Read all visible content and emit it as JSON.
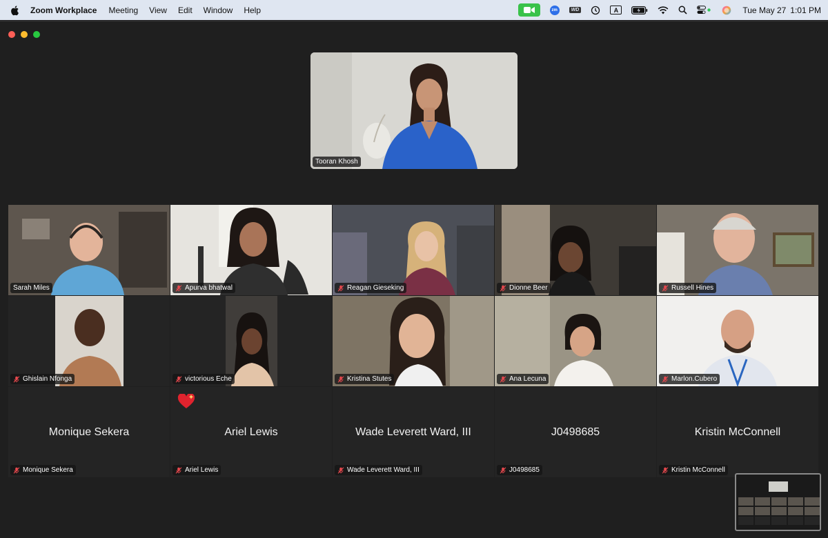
{
  "menubar": {
    "app_name": "Zoom Workplace",
    "menus": [
      "Meeting",
      "View",
      "Edit",
      "Window",
      "Help"
    ],
    "status_icons": [
      "video-camera-icon",
      "zoom-icon",
      "wd-drive-icon",
      "time-machine-icon",
      "input-source-icon",
      "battery-icon",
      "wifi-icon",
      "search-icon",
      "control-center-icon",
      "siri-icon"
    ],
    "zoom_badge": "zm",
    "wd_badge": "WD",
    "input_source": "A",
    "date": "Tue May 27",
    "time": "1:01 PM"
  },
  "window": {
    "traffic_lights": [
      "close",
      "minimize",
      "maximize"
    ]
  },
  "active_speaker": {
    "name": "Tooran Khosh"
  },
  "participants": [
    {
      "name": "Sarah Miles",
      "muted": false,
      "video": true
    },
    {
      "name": "Apurva bhatwal",
      "muted": true,
      "video": true
    },
    {
      "name": "Reagan Gieseking",
      "muted": true,
      "video": true
    },
    {
      "name": "Dionne Beer",
      "muted": true,
      "video": true
    },
    {
      "name": "Russell Hines",
      "muted": true,
      "video": true
    },
    {
      "name": "Ghislain Nfonga",
      "muted": true,
      "video": true
    },
    {
      "name": "victorious Eche",
      "muted": true,
      "video": true
    },
    {
      "name": "Kristina Stutes",
      "muted": true,
      "video": true
    },
    {
      "name": "Ana Lecuna",
      "muted": true,
      "video": true
    },
    {
      "name": "Marlon.Cubero",
      "muted": true,
      "video": true
    },
    {
      "name": "Monique Sekera",
      "muted": true,
      "video": false
    },
    {
      "name": "Ariel Lewis",
      "muted": true,
      "video": false,
      "reaction": "heart-icon"
    },
    {
      "name": "Wade Leverett Ward, III",
      "muted": true,
      "video": false
    },
    {
      "name": "J0498685",
      "muted": true,
      "video": false
    },
    {
      "name": "Kristin McConnell",
      "muted": true,
      "video": false
    }
  ],
  "colors": {
    "menubar_bg": "#dfe6f1",
    "window_bg": "#1f1f1f",
    "tile_bg": "#242424",
    "mute_red": "#e5484d",
    "camera_green": "#39c24a"
  }
}
